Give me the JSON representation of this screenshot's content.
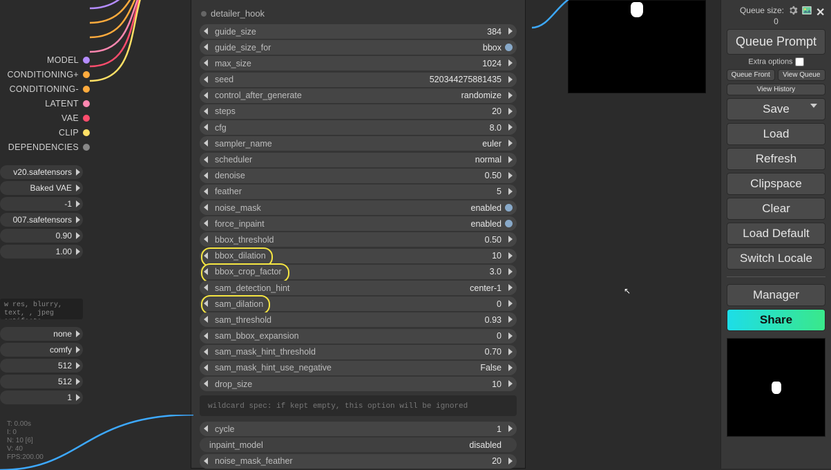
{
  "node": {
    "title": "detailer_hook",
    "params": [
      {
        "name": "guide_size",
        "value": "384",
        "type": "num"
      },
      {
        "name": "guide_size_for",
        "value": "bbox",
        "type": "toggle"
      },
      {
        "name": "max_size",
        "value": "1024",
        "type": "num"
      },
      {
        "name": "seed",
        "value": "520344275881435",
        "type": "num"
      },
      {
        "name": "control_after_generate",
        "value": "randomize",
        "type": "num"
      },
      {
        "name": "steps",
        "value": "20",
        "type": "num"
      },
      {
        "name": "cfg",
        "value": "8.0",
        "type": "num"
      },
      {
        "name": "sampler_name",
        "value": "euler",
        "type": "num"
      },
      {
        "name": "scheduler",
        "value": "normal",
        "type": "num"
      },
      {
        "name": "denoise",
        "value": "0.50",
        "type": "num"
      },
      {
        "name": "feather",
        "value": "5",
        "type": "num"
      },
      {
        "name": "noise_mask",
        "value": "enabled",
        "type": "toggle"
      },
      {
        "name": "force_inpaint",
        "value": "enabled",
        "type": "toggle"
      },
      {
        "name": "bbox_threshold",
        "value": "0.50",
        "type": "num"
      },
      {
        "name": "bbox_dilation",
        "value": "10",
        "type": "num",
        "hl": "hl"
      },
      {
        "name": "bbox_crop_factor",
        "value": "3.0",
        "type": "num",
        "hl": "hl-wide"
      },
      {
        "name": "sam_detection_hint",
        "value": "center-1",
        "type": "num"
      },
      {
        "name": "sam_dilation",
        "value": "0",
        "type": "num",
        "hl": "hl-sam"
      },
      {
        "name": "sam_threshold",
        "value": "0.93",
        "type": "num"
      },
      {
        "name": "sam_bbox_expansion",
        "value": "0",
        "type": "num"
      },
      {
        "name": "sam_mask_hint_threshold",
        "value": "0.70",
        "type": "num"
      },
      {
        "name": "sam_mask_hint_use_negative",
        "value": "False",
        "type": "num"
      },
      {
        "name": "drop_size",
        "value": "10",
        "type": "num"
      }
    ],
    "wildcard_text": "wildcard spec: if kept empty, this option will be ignored",
    "params_after": [
      {
        "name": "cycle",
        "value": "1",
        "type": "num"
      },
      {
        "name": "inpaint_model",
        "value": "disabled",
        "type": "locked"
      },
      {
        "name": "noise_mask_feather",
        "value": "20",
        "type": "num"
      }
    ]
  },
  "ports": [
    {
      "label": "MODEL",
      "color": "#b58cff"
    },
    {
      "label": "CONDITIONING+",
      "color": "#ffab3d"
    },
    {
      "label": "CONDITIONING-",
      "color": "#ffab3d"
    },
    {
      "label": "LATENT",
      "color": "#ff87b0"
    },
    {
      "label": "VAE",
      "color": "#ff4d6d"
    },
    {
      "label": "CLIP",
      "color": "#ffe066"
    },
    {
      "label": "DEPENDENCIES",
      "color": "#888888"
    }
  ],
  "left_widgets": [
    "v20.safetensors",
    "Baked VAE",
    "-1",
    "007.safetensors",
    "0.90",
    "1.00"
  ],
  "left_widgets2": [
    "none",
    "comfy",
    "512",
    "512",
    "1"
  ],
  "neg_prompt": "w res, blurry, text, , jpeg artifacts,",
  "stats": {
    "t": "T: 0.00s",
    "i": "I: 0",
    "n": "N: 10 [6]",
    "v": "V: 40",
    "fps": "FPS:200.00"
  },
  "sidebar": {
    "queue_label": "Queue size:",
    "queue_size": "0",
    "queue_prompt": "Queue Prompt",
    "extra": "Extra options",
    "queue_front": "Queue Front",
    "view_queue": "View Queue",
    "view_history": "View History",
    "save": "Save",
    "load": "Load",
    "refresh": "Refresh",
    "clipspace": "Clipspace",
    "clear": "Clear",
    "load_default": "Load Default",
    "switch_locale": "Switch Locale",
    "manager": "Manager",
    "share": "Share"
  }
}
